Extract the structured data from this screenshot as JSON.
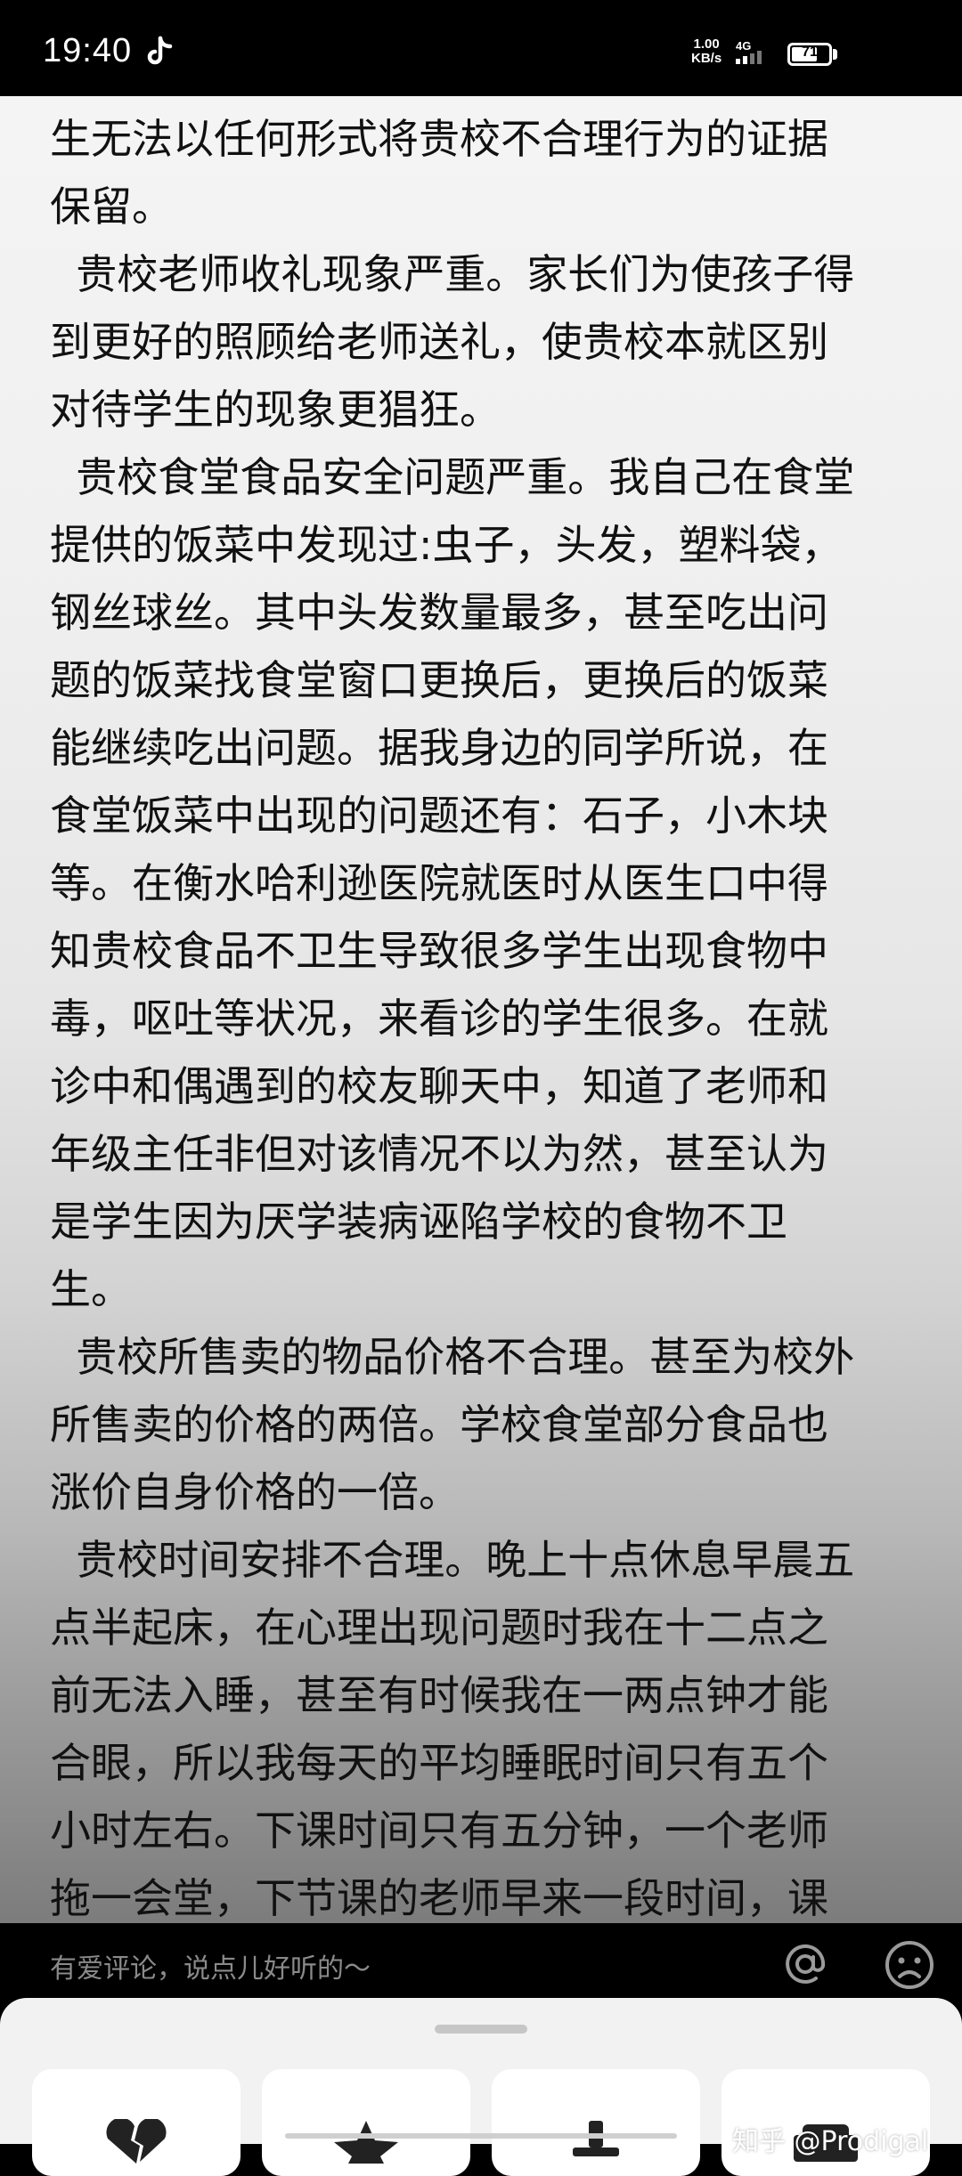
{
  "status_bar": {
    "time": "19:40",
    "net_speed_value": "1.00",
    "net_speed_unit": "KB/s",
    "network": "4G",
    "battery": "71",
    "battery_fraction": 0.71
  },
  "article": {
    "paragraphs": [
      "生无法以任何形式将贵校不合理行为的证据\n保留。",
      "  贵校老师收礼现象严重。家长们为使孩子得\n到更好的照顾给老师送礼，使贵校本就区别\n对待学生的现象更猖狂。",
      "  贵校食堂食品安全问题严重。我自己在食堂\n提供的饭菜中发现过:虫子，头发，塑料袋，\n钢丝球丝。其中头发数量最多，甚至吃出问\n题的饭菜找食堂窗口更换后，更换后的饭菜\n能继续吃出问题。据我身边的同学所说，在\n食堂饭菜中出现的问题还有：石子，小木块\n等。在衡水哈利逊医院就医时从医生口中得\n知贵校食品不卫生导致很多学生出现食物中\n毒，呕吐等状况，来看诊的学生很多。在就\n诊中和偶遇到的校友聊天中，知道了老师和\n年级主任非但对该情况不以为然，甚至认为\n是学生因为厌学装病诬陷学校的食物不卫\n生。",
      "  贵校所售卖的物品价格不合理。甚至为校外\n所售卖的价格的两倍。学校食堂部分食品也\n涨价自身价格的一倍。",
      "  贵校时间安排不合理。晚上十点休息早晨五\n点半起床，在心理出现问题时我在十二点之\n前无法入睡，甚至有时候我在一两点钟才能\n合眼，所以我每天的平均睡眠时间只有五个\n小时左右。下课时间只有五分钟，一个老师\n拖一会堂，下节课的老师早来一段时间，课"
    ]
  },
  "comment_bar": {
    "placeholder": "有爱评论，说点儿好听的～",
    "at_icon": "at-icon",
    "emoji_icon": "emoji-icon"
  },
  "watermark": "知乎 @Prodigal",
  "sheet": {
    "cards": [
      "broken-heart-icon",
      "star-icon",
      "pin-icon",
      "sofa-icon"
    ]
  }
}
